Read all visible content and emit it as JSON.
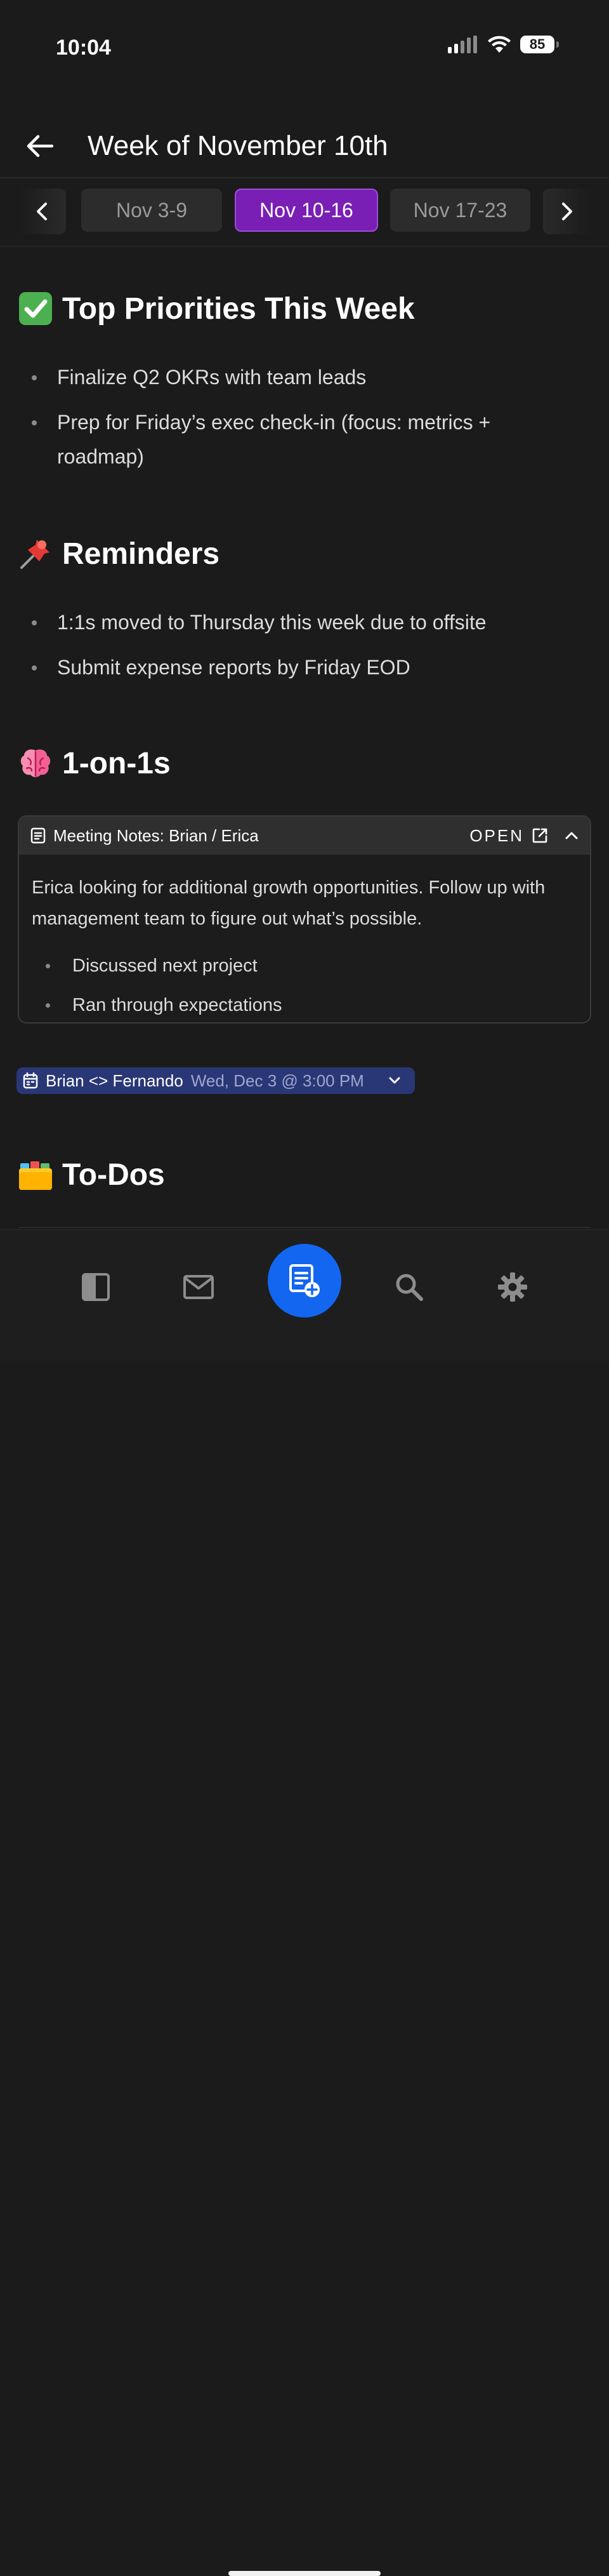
{
  "status_bar": {
    "time": "10:04",
    "battery": "85"
  },
  "header": {
    "title": "Week of November 10th"
  },
  "weeks": {
    "tabs": [
      {
        "label": "Nov 3-9"
      },
      {
        "label": "Nov 10-16",
        "active": true
      },
      {
        "label": "Nov 17-23"
      }
    ]
  },
  "sections": {
    "priorities": {
      "emoji": "check-mark-icon",
      "title": "Top Priorities This Week",
      "items": [
        "Finalize Q2 OKRs with team leads",
        "Prep for Friday’s exec check-in (focus: metrics + roadmap)"
      ]
    },
    "reminders": {
      "emoji": "pushpin-icon",
      "title": "Reminders",
      "items": [
        "1:1s moved to Thursday this week due to offsite",
        "Submit expense reports by Friday EOD"
      ]
    },
    "one_on_ones": {
      "emoji": "brain-icon",
      "title": "1-on-1s",
      "note_card": {
        "title": "Meeting Notes: Brian / Erica",
        "open_label": "OPEN",
        "body": "Erica looking for additional growth opportunities. Follow up with management team to figure out what’s possible.",
        "items": [
          "Discussed next project",
          "Ran through expectations"
        ]
      },
      "calendar_event": {
        "name": "Brian <> Fernando",
        "datetime": "Wed, Dec 3 @ 3:00 PM"
      }
    },
    "todos": {
      "emoji": "card-index-dividers-icon",
      "title": "To-Dos"
    }
  },
  "colors": {
    "accent": "#7a1fb6",
    "fab": "#1366f0",
    "calendar_chip": "#2a3776",
    "background": "#1b1b1b"
  }
}
